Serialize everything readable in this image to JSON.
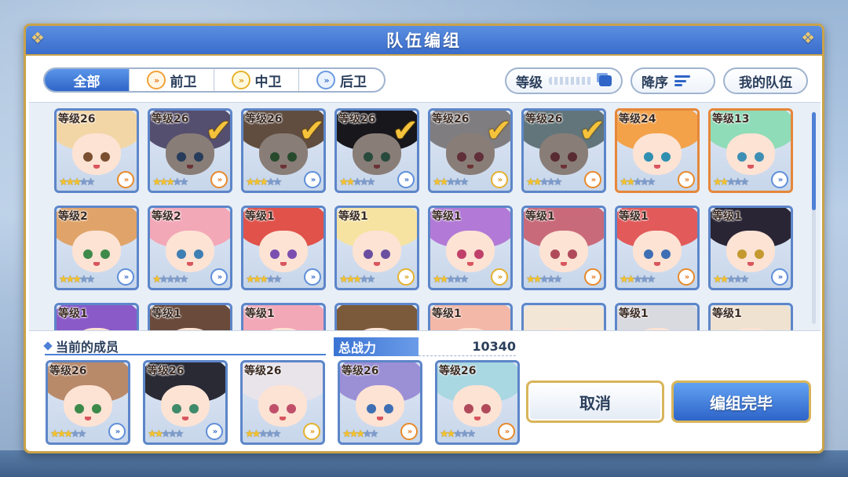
{
  "title": "队伍编组",
  "filter_tabs": [
    {
      "label": "全部",
      "active": true,
      "icon": null
    },
    {
      "label": "前卫",
      "active": false,
      "icon": "front-role-icon"
    },
    {
      "label": "中卫",
      "active": false,
      "icon": "mid-role-icon"
    },
    {
      "label": "后卫",
      "active": false,
      "icon": "back-role-icon"
    }
  ],
  "sort": {
    "level_label": "等级",
    "order_label": "降序",
    "my_team_label": "我的队伍"
  },
  "roster": [
    {
      "level": "等级26",
      "stars": 3,
      "role": "front",
      "hair": "#f3d6a6",
      "eyes": "#7a4f2f",
      "selected": false
    },
    {
      "level": "等级26",
      "stars": 3,
      "role": "front",
      "hair": "#9b8fd6",
      "eyes": "#3e6fb4",
      "selected": true
    },
    {
      "level": "等级26",
      "stars": 3,
      "role": "back",
      "hair": "#b98a6a",
      "eyes": "#3c8a4a",
      "selected": true
    },
    {
      "level": "等级26",
      "stars": 2,
      "role": "back",
      "hair": "#2a2a35",
      "eyes": "#3e8a6a",
      "selected": true
    },
    {
      "level": "等级26",
      "stars": 2,
      "role": "mid",
      "hair": "#e9e3ea",
      "eyes": "#c0506a",
      "selected": true
    },
    {
      "level": "等级26",
      "stars": 2,
      "role": "front",
      "hair": "#a9d7e2",
      "eyes": "#b04a5a",
      "selected": true
    },
    {
      "level": "等级24",
      "stars": 2,
      "role": "front",
      "hair": "#f3a24a",
      "eyes": "#2f8fb0",
      "selected": false,
      "tier": "orange"
    },
    {
      "level": "等级13",
      "stars": 2,
      "role": "back",
      "hair": "#8fdcb8",
      "eyes": "#3e8fb4",
      "selected": false,
      "tier": "orange"
    },
    {
      "level": "等级2",
      "stars": 3,
      "role": "back",
      "hair": "#e0a46a",
      "eyes": "#3f8a4a",
      "selected": false
    },
    {
      "level": "等级2",
      "stars": 1,
      "role": "back",
      "hair": "#f3a8b8",
      "eyes": "#3e7fb4",
      "selected": false
    },
    {
      "level": "等级1",
      "stars": 3,
      "role": "back",
      "hair": "#e0524a",
      "eyes": "#7a4fb0",
      "selected": false
    },
    {
      "level": "等级1",
      "stars": 3,
      "role": "mid",
      "hair": "#f6e3a2",
      "eyes": "#6a4fa0",
      "selected": false
    },
    {
      "level": "等级1",
      "stars": 2,
      "role": "mid",
      "hair": "#b27ad6",
      "eyes": "#c0406a",
      "selected": false
    },
    {
      "level": "等级1",
      "stars": 2,
      "role": "front",
      "hair": "#c96a7a",
      "eyes": "#b04a5a",
      "selected": false
    },
    {
      "level": "等级1",
      "stars": 2,
      "role": "front",
      "hair": "#e25a5a",
      "eyes": "#3e6fb4",
      "selected": false
    },
    {
      "level": "等级1",
      "stars": 2,
      "role": "back",
      "hair": "#2a2535",
      "eyes": "#c49a30",
      "selected": false
    },
    {
      "level": "等级1",
      "stars": 0,
      "role": "",
      "hair": "#8a5ac8",
      "eyes": "#3e6fb4",
      "selected": false,
      "partial": true
    },
    {
      "level": "等级1",
      "stars": 0,
      "role": "",
      "hair": "#6a4a3a",
      "eyes": "#3e6fb4",
      "selected": false,
      "partial": true
    },
    {
      "level": "等级1",
      "stars": 0,
      "role": "",
      "hair": "#f3a8b8",
      "eyes": "#3e6fb4",
      "selected": false,
      "partial": true
    },
    {
      "level": "",
      "stars": 0,
      "role": "",
      "hair": "#7a5a3a",
      "eyes": "#3e6fb4",
      "selected": false,
      "partial": true
    },
    {
      "level": "等级1",
      "stars": 0,
      "role": "",
      "hair": "#f3b8a8",
      "eyes": "#3e6fb4",
      "selected": false,
      "partial": true
    },
    {
      "level": "",
      "stars": 0,
      "role": "",
      "hair": "#f2e6d6",
      "eyes": "#3e6fb4",
      "selected": false,
      "partial": true
    },
    {
      "level": "等级1",
      "stars": 0,
      "role": "",
      "hair": "#d9d9e0",
      "eyes": "#3e6fb4",
      "selected": false,
      "partial": true
    },
    {
      "level": "等级1",
      "stars": 0,
      "role": "",
      "hair": "#f0e2d0",
      "eyes": "#3e6fb4",
      "selected": false,
      "partial": true
    }
  ],
  "members_header": "当前的成员",
  "total_power_label": "总战力",
  "total_power_value": "10340",
  "members": [
    {
      "level": "等级26",
      "stars": 3,
      "role": "back",
      "hair": "#b98a6a",
      "eyes": "#3c8a4a"
    },
    {
      "level": "等级26",
      "stars": 2,
      "role": "back",
      "hair": "#2a2a35",
      "eyes": "#3e8a6a"
    },
    {
      "level": "等级26",
      "stars": 2,
      "role": "mid",
      "hair": "#e9e3ea",
      "eyes": "#c0506a"
    },
    {
      "level": "等级26",
      "stars": 3,
      "role": "front",
      "hair": "#9b8fd6",
      "eyes": "#3e6fb4"
    },
    {
      "level": "等级26",
      "stars": 2,
      "role": "front",
      "hair": "#a9d7e2",
      "eyes": "#b04a5a"
    }
  ],
  "buttons": {
    "cancel": "取消",
    "confirm": "编组完毕"
  },
  "colors": {
    "accent": "#3a6ccb",
    "gold": "#c9a24a",
    "check": "#f5c23b"
  }
}
